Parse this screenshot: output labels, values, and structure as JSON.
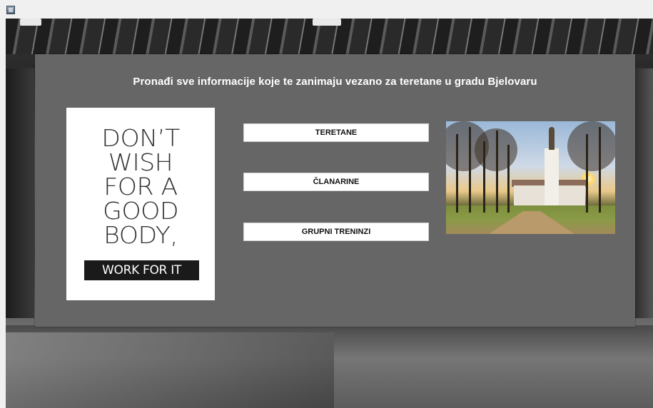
{
  "window": {
    "title": "",
    "icon": "java-app-icon"
  },
  "header": {
    "title": "Pronađi sve informacije koje te zanimaju vezano za teretane u gradu Bjelovaru"
  },
  "poster": {
    "lines": [
      "DON’T",
      "WISH",
      "FOR A",
      "GOOD",
      "BODY,"
    ],
    "tagline": "WORK FOR IT"
  },
  "buttons": {
    "gyms": "TERETANE",
    "memberships": "ČLANARINE",
    "group_trainings": "GRUPNI TRENINZI"
  },
  "photo": {
    "subject": "Bjelovar church and park at sunset"
  },
  "colors": {
    "panel": "#666666",
    "heading_text": "#ffffff",
    "button_bg": "#ffffff",
    "button_text": "#111111"
  }
}
